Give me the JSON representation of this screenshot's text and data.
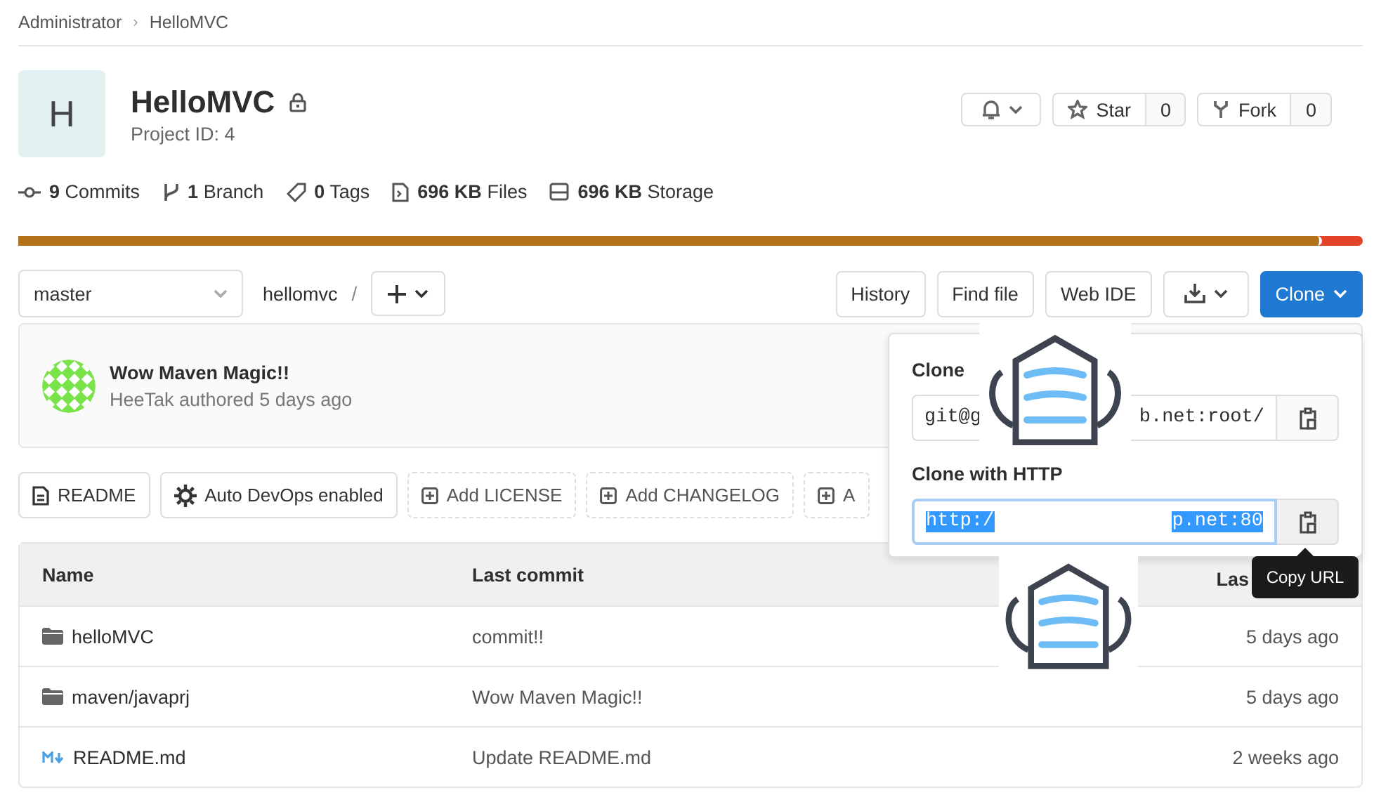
{
  "breadcrumb": [
    {
      "label": "Administrator"
    },
    {
      "label": "HelloMVC"
    }
  ],
  "breadcrumb_separator": "›",
  "project": {
    "avatar_letter": "H",
    "name": "HelloMVC",
    "private": true,
    "id_label": "Project ID: 4"
  },
  "actions": {
    "notification": {
      "kind": "bell"
    },
    "star": {
      "label": "Star",
      "count": "0"
    },
    "fork": {
      "label": "Fork",
      "count": "0"
    }
  },
  "stats": [
    {
      "kind": "commit",
      "value": "9",
      "label": "Commits"
    },
    {
      "kind": "branch",
      "value": "1",
      "label": "Branch"
    },
    {
      "kind": "tag",
      "value": "0",
      "label": "Tags"
    },
    {
      "kind": "files",
      "value": "696 KB",
      "label": "Files"
    },
    {
      "kind": "storage",
      "value": "696 KB",
      "label": "Storage"
    }
  ],
  "language_bar": {
    "level": 0.97
  },
  "toolbar": {
    "branch": "master",
    "path": "hellomvc",
    "separator": "/",
    "buttons": [
      "History",
      "Find file",
      "Web IDE"
    ],
    "clone": "Clone"
  },
  "last_commit": {
    "title": "Wow Maven Magic!!",
    "meta": "HeeTak authored 5 days ago"
  },
  "quick_buttons": [
    {
      "kind": "file",
      "label": "README",
      "dashed": false
    },
    {
      "kind": "gear",
      "label": "Auto DevOps enabled",
      "dashed": false
    },
    {
      "kind": "add",
      "label": "Add LICENSE",
      "dashed": true
    },
    {
      "kind": "add",
      "label": "Add CHANGELOG",
      "dashed": true
    },
    {
      "kind": "add",
      "label": "A",
      "dashed": true
    }
  ],
  "table": {
    "columns": [
      "Name",
      "Last commit",
      "Las"
    ],
    "rows": [
      {
        "kind": "folder",
        "name": "helloMVC",
        "commit": "commit!!",
        "updated": "5 days ago"
      },
      {
        "kind": "folder",
        "name": "maven/javaprj",
        "commit": "Wow Maven Magic!!",
        "updated": "5 days ago"
      },
      {
        "kind": "markdown",
        "name": "README.md",
        "commit": "Update README.md",
        "updated": "2 weeks ago"
      }
    ]
  },
  "clone_dropdown": {
    "ssh_label": "Clone",
    "ssh_start": "git@g",
    "ssh_end": "b.net:root/",
    "http_label": "Clone with HTTP",
    "http_start": "http:/",
    "http_end": "p.net:80",
    "http_selected": true,
    "tooltip": "Copy URL"
  }
}
